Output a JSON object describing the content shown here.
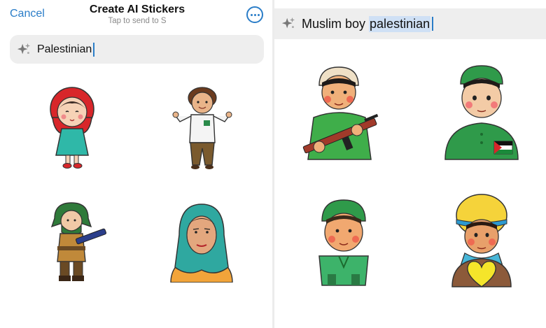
{
  "left_panel": {
    "header": {
      "cancel_label": "Cancel",
      "title": "Create AI Stickers",
      "subtitle": "Tap to send to S",
      "more_icon": "ellipsis-circle-icon"
    },
    "search": {
      "icon": "sparkle-icon",
      "value": "Palestinian"
    },
    "stickers": [
      "girl in red headscarf and teal dress",
      "boy with curly hair waving",
      "fighter in green headscarf holding rifle",
      "woman in teal hijab"
    ]
  },
  "right_panel": {
    "search": {
      "icon": "sparkle-icon",
      "value_prefix": "Muslim boy ",
      "value_selected": "palestinian"
    },
    "stickers": [
      "boy in cap holding rifle",
      "boy in green cap with flag on shirt",
      "boy in green cap and green shirt",
      "boy in yellow turban with yellow heart"
    ]
  },
  "colors": {
    "accent": "#2a7dc8",
    "search_bg": "#eeeeee",
    "selection": "#cfe0f5"
  }
}
